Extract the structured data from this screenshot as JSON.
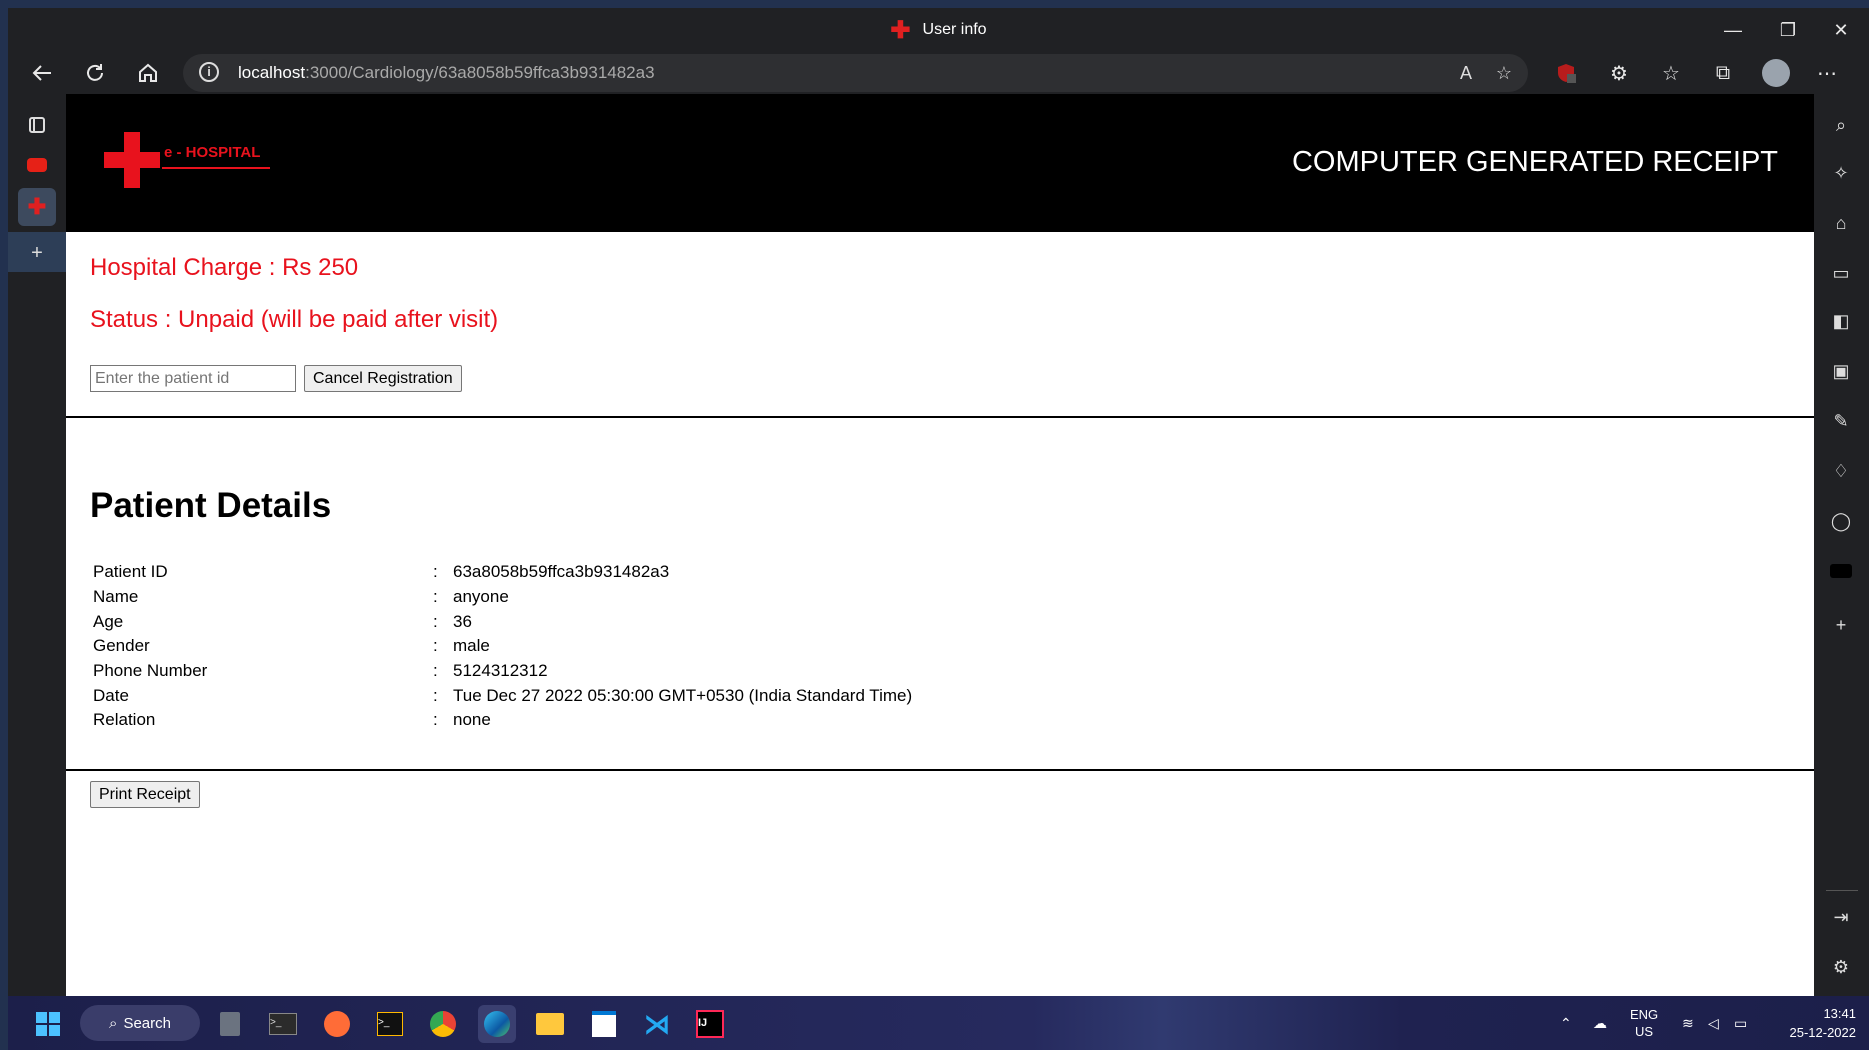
{
  "browser": {
    "tab_title": "User info",
    "url_host": "localhost",
    "url_path": ":3000/Cardiology/63a8058b59ffca3b931482a3",
    "win_minimize": "—",
    "win_restore": "❐",
    "win_close": "✕"
  },
  "header": {
    "logo_text": "e - HOSPITAL",
    "receipt_title": "COMPUTER GENERATED RECEIPT"
  },
  "registration": {
    "charge": "Hospital Charge : Rs 250",
    "status": "Status : Unpaid (will be paid after visit)",
    "patient_id_placeholder": "Enter the patient id",
    "cancel_label": "Cancel Registration"
  },
  "details": {
    "title": "Patient Details",
    "separator": ":",
    "rows": [
      {
        "label": "Patient ID",
        "value": "63a8058b59ffca3b931482a3"
      },
      {
        "label": "Name",
        "value": "anyone"
      },
      {
        "label": "Age",
        "value": "36"
      },
      {
        "label": "Gender",
        "value": "male"
      },
      {
        "label": "Phone Number",
        "value": "5124312312"
      },
      {
        "label": "Date",
        "value": "Tue Dec 27 2022 05:30:00 GMT+0530 (India Standard Time)"
      },
      {
        "label": "Relation",
        "value": "none"
      }
    ]
  },
  "print_label": "Print Receipt",
  "taskbar": {
    "search_label": "Search",
    "lang_top": "ENG",
    "lang_bottom": "US",
    "time": "13:41",
    "date": "25-12-2022"
  },
  "colors": {
    "accent_red": "#e8121d",
    "header_bg": "#000000",
    "browser_chrome": "#202124"
  }
}
